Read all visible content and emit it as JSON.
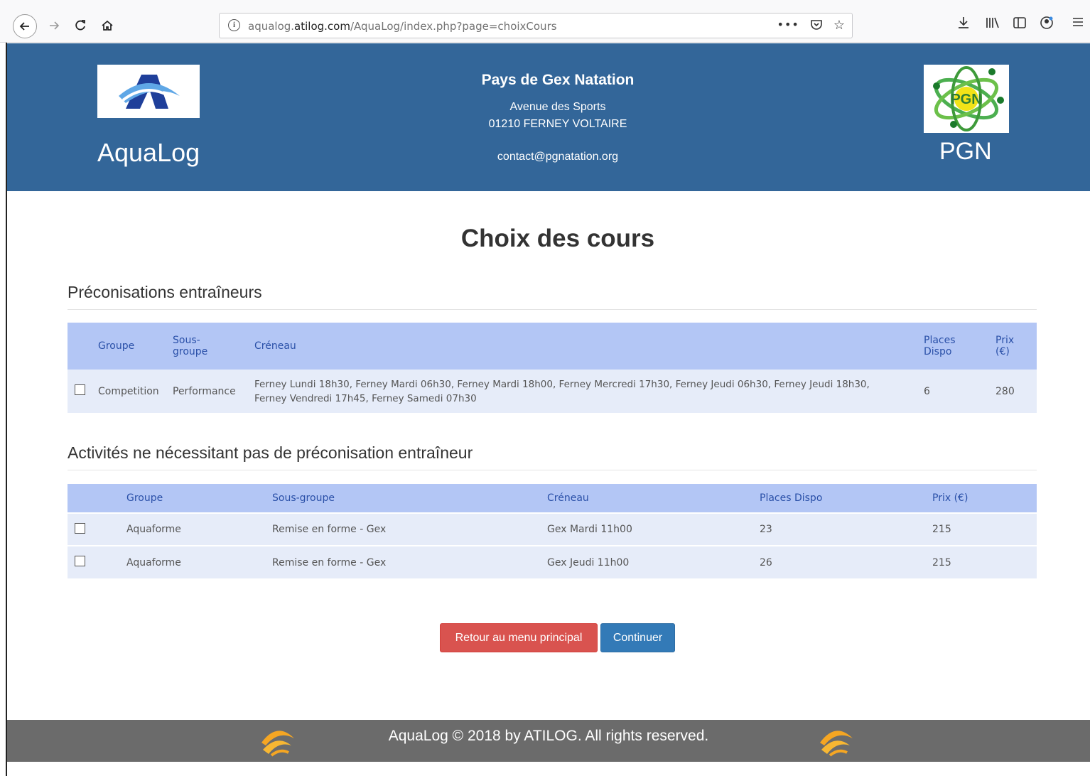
{
  "browser": {
    "url_prefix": "aqualog.",
    "url_domain": "atilog.com",
    "url_path": "/AquaLog/index.php?page=choixCours",
    "icons": [
      "back-icon",
      "forward-icon",
      "reload-icon",
      "home-icon",
      "info-icon",
      "more-icon",
      "pocket-icon",
      "bookmark-star-icon",
      "download-icon",
      "library-icon",
      "sidebar-icon",
      "account-icon",
      "menu-icon"
    ]
  },
  "header": {
    "app_name": "AquaLog",
    "club_name": "Pays de Gex Natation",
    "address_line1": "Avenue des Sports",
    "address_line2": "01210 FERNEY VOLTAIRE",
    "email": "contact@pgnatation.org",
    "club_abbr": "PGN",
    "club_logo_text": "PGN",
    "background_color": "#336699"
  },
  "main": {
    "title": "Choix des cours",
    "section1": {
      "title": "Préconisations entraîneurs",
      "headers": {
        "groupe": "Groupe",
        "sous_groupe_1": "Sous-",
        "sous_groupe_2": "groupe",
        "creneau": "Créneau",
        "places_1": "Places",
        "places_2": "Dispo",
        "prix_1": "Prix",
        "prix_2": "(€)"
      },
      "rows": [
        {
          "groupe": "Competition",
          "sous_groupe": "Performance",
          "creneau_1": "Ferney Lundi 18h30, Ferney Mardi 06h30, Ferney Mardi 18h00, Ferney Mercredi 17h30, Ferney Jeudi 06h30, Ferney Jeudi 18h30,",
          "creneau_2": "Ferney Vendredi 17h45, Ferney Samedi 07h30",
          "places": "6",
          "prix": "280",
          "checked": false
        }
      ]
    },
    "section2": {
      "title": "Activités ne nécessitant pas de préconisation entraîneur",
      "headers": {
        "groupe": "Groupe",
        "sous_groupe": "Sous-groupe",
        "creneau": "Créneau",
        "places": "Places Dispo",
        "prix": "Prix (€)"
      },
      "rows": [
        {
          "groupe": "Aquaforme",
          "sous_groupe": "Remise en forme - Gex",
          "creneau": "Gex Mardi 11h00",
          "places": "23",
          "prix": "215",
          "checked": false
        },
        {
          "groupe": "Aquaforme",
          "sous_groupe": "Remise en forme - Gex",
          "creneau": "Gex Jeudi 11h00",
          "places": "26",
          "prix": "215",
          "checked": false
        }
      ]
    },
    "buttons": {
      "back": "Retour au menu principal",
      "continue": "Continuer",
      "back_color": "#d9534f",
      "continue_color": "#337ab7"
    }
  },
  "footer": {
    "text": "AquaLog © 2018 by ATILOG. All rights reserved.",
    "background_color": "#6b6b6b"
  }
}
